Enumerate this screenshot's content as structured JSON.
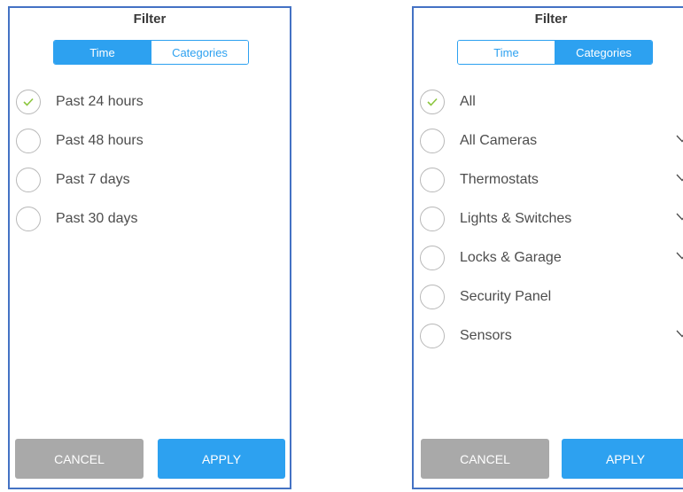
{
  "colors": {
    "accent": "#2da1f0",
    "check": "#8cc63f",
    "cancel": "#a9a9a9",
    "border": "#4472c4"
  },
  "left_panel": {
    "title": "Filter",
    "tabs": [
      {
        "label": "Time",
        "active": true
      },
      {
        "label": "Categories",
        "active": false
      }
    ],
    "options": [
      {
        "label": "Past 24 hours",
        "selected": true
      },
      {
        "label": "Past 48 hours",
        "selected": false
      },
      {
        "label": "Past 7 days",
        "selected": false
      },
      {
        "label": "Past 30 days",
        "selected": false
      }
    ],
    "cancel_label": "CANCEL",
    "apply_label": "APPLY"
  },
  "right_panel": {
    "title": "Filter",
    "tabs": [
      {
        "label": "Time",
        "active": false
      },
      {
        "label": "Categories",
        "active": true
      }
    ],
    "options": [
      {
        "label": "All",
        "selected": true,
        "expandable": false
      },
      {
        "label": "All Cameras",
        "selected": false,
        "expandable": true
      },
      {
        "label": "Thermostats",
        "selected": false,
        "expandable": true
      },
      {
        "label": "Lights & Switches",
        "selected": false,
        "expandable": true
      },
      {
        "label": "Locks & Garage",
        "selected": false,
        "expandable": true
      },
      {
        "label": "Security Panel",
        "selected": false,
        "expandable": false
      },
      {
        "label": "Sensors",
        "selected": false,
        "expandable": true
      }
    ],
    "cancel_label": "CANCEL",
    "apply_label": "APPLY"
  }
}
